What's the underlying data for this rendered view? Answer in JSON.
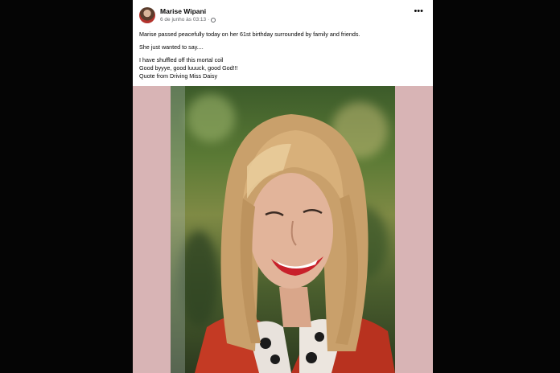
{
  "post": {
    "author": "Marise Wipani",
    "timestamp": "6 de junho às 03:13",
    "separator": "·",
    "privacy_icon": "globe-icon",
    "more_icon": "ellipsis-icon",
    "paragraphs": [
      "Marise passed peacefully today on her 61st birthday surrounded by family and friends.",
      "She just wanted to say....",
      "I have shuffled off this mortal coil",
      "Good byyye, good luuuck, good God!!!",
      "Quote from Driving Miss Daisy"
    ]
  },
  "colors": {
    "page_background": "#050505",
    "card_background": "#ffffff",
    "media_background": "#d8b4b5",
    "text": "#050505",
    "secondary_text": "#65676b"
  }
}
